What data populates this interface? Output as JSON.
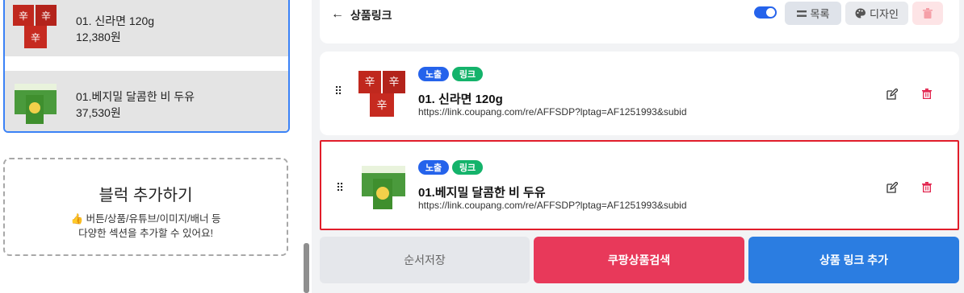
{
  "preview": {
    "items": [
      {
        "name": "01. 신라면 120g",
        "price": "12,380원"
      },
      {
        "name": "01.베지밀 달콤한 비 두유",
        "price": "37,530원"
      }
    ]
  },
  "add_block": {
    "title": "블럭 추가하기",
    "desc_line1": "👍 버튼/상품/유튜브/이미지/배너 등",
    "desc_line2": "다양한 섹션을 추가할 수 있어요!"
  },
  "topbar": {
    "back_icon": "←",
    "title": "상품링크",
    "list_label": "목록",
    "design_label": "디자인"
  },
  "cards": [
    {
      "badge_show": "노출",
      "badge_link": "링크",
      "title": "01. 신라면 120g",
      "url": "https://link.coupang.com/re/AFFSDP?lptag=AF1251993&subid"
    },
    {
      "badge_show": "노출",
      "badge_link": "링크",
      "title": "01.베지밀 달콤한 비 두유",
      "url": "https://link.coupang.com/re/AFFSDP?lptag=AF1251993&subid"
    }
  ],
  "actions": {
    "save_order": "순서저장",
    "coupang_search": "쿠팡상품검색",
    "add_link": "상품 링크 추가"
  },
  "colors": {
    "accent_blue": "#2b7de1",
    "accent_red": "#e8395a",
    "badge_green": "#14b36b"
  }
}
